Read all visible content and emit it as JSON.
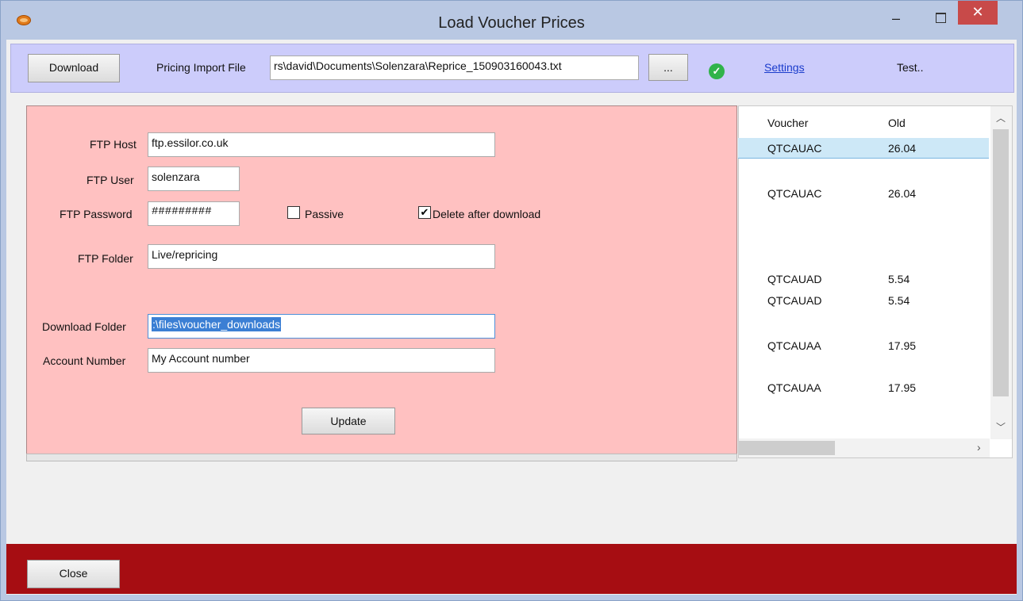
{
  "window": {
    "title": "Load Voucher Prices",
    "minimize": "–",
    "close": "✕"
  },
  "toolbar": {
    "download_label": "Download",
    "pricing_import_label": "Pricing Import File",
    "pricing_import_value": "rs\\david\\Documents\\Solenzara\\Reprice_150903160043.txt",
    "browse_label": "...",
    "status_icon": "check-circle-icon",
    "settings_label": "Settings",
    "test_label": "Test.."
  },
  "form": {
    "ftp_host_label": "FTP Host",
    "ftp_host_value": "ftp.essilor.co.uk",
    "ftp_user_label": "FTP User",
    "ftp_user_value": "solenzara",
    "ftp_password_label": "FTP Password",
    "ftp_password_value": "#########",
    "passive_label": "Passive",
    "passive_checked": false,
    "delete_label": "Delete after download",
    "delete_checked": true,
    "ftp_folder_label": "FTP Folder",
    "ftp_folder_value": "Live/repricing",
    "download_folder_label": "Download Folder",
    "download_folder_value": ":\\files\\voucher_downloads",
    "account_number_label": "Account Number",
    "account_number_value": "My Account number",
    "update_label": "Update"
  },
  "grid": {
    "columns": [
      "Voucher",
      "Old"
    ],
    "rows": [
      {
        "voucher": "QTCAUAC",
        "old": "26.04"
      },
      {
        "voucher": "QTCAUAC",
        "old": "26.04"
      },
      {
        "voucher": "QTCAUAD",
        "old": "5.54"
      },
      {
        "voucher": "QTCAUAD",
        "old": "5.54"
      },
      {
        "voucher": "QTCAUAA",
        "old": "17.95"
      },
      {
        "voucher": "QTCAUAA",
        "old": "17.95"
      }
    ]
  },
  "footer": {
    "close_label": "Close"
  },
  "colors": {
    "toolbar": "#ccccfb",
    "panel": "#ffc1c1",
    "footer": "#a60d12"
  }
}
